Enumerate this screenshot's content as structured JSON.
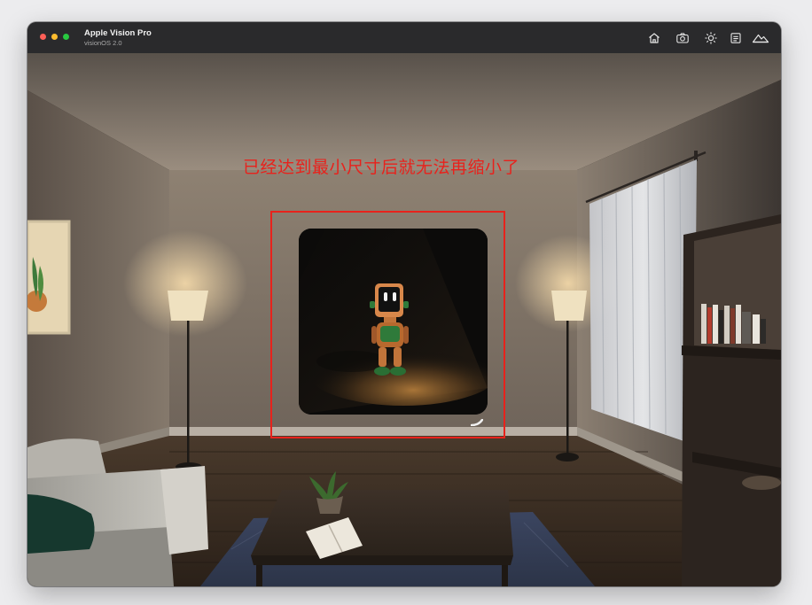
{
  "window": {
    "app_title": "Apple Vision Pro",
    "app_subtitle": "visionOS 2.0"
  },
  "toolbar": {
    "icons": [
      "home-icon",
      "camera-icon",
      "brightness-icon",
      "device-icon",
      "environment-icon"
    ]
  },
  "annotation": {
    "caption": "已经达到最小尺寸后就无法再缩小了",
    "color": "#e8221c"
  },
  "colors": {
    "titlebar": "#2a2a2c",
    "close": "#fe5f57",
    "minimize": "#febc2e",
    "maximize": "#28c840"
  }
}
